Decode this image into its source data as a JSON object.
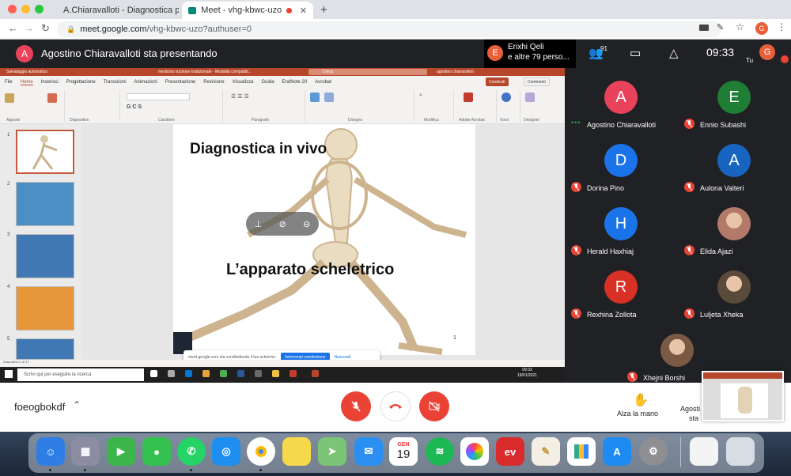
{
  "browser": {
    "tabs": [
      {
        "label": "A.Chiaravalloti - Diagnostica p",
        "icon": "drive-icon"
      },
      {
        "label": "Meet - vhg-kbwc-uzo",
        "icon": "meet-icon"
      }
    ],
    "url_host": "meet.google.com",
    "url_path": "/vhg-kbwc-uzo?authuser=0",
    "profile_initial": "G"
  },
  "meet": {
    "presenter_initial": "A",
    "presenter_banner": "Agostino Chiaravalloti sta presentando",
    "pinned": {
      "initial": "E",
      "line1": "Enxhi Qeli",
      "line2": "e altre 79 perso..."
    },
    "people_count": "91",
    "clock": "09:33",
    "you_label": "Tu",
    "you_initial": "G",
    "meeting_code": "foeogbokdf",
    "raise_hand_label": "Alza la mano",
    "self_caption_1": "Agosti",
    "self_caption_2": "sta",
    "participants": [
      {
        "name": "Agostino Chiaravalloti",
        "initial": "A",
        "color": "#e8435a",
        "muted": false,
        "photo": false
      },
      {
        "name": "Ennio Subashi",
        "initial": "E",
        "color": "#1e7e34",
        "muted": true,
        "photo": false
      },
      {
        "name": "Dorina Pino",
        "initial": "D",
        "color": "#1a73e8",
        "muted": true,
        "photo": false
      },
      {
        "name": "Aulona Valteri",
        "initial": "A",
        "color": "#1765c1",
        "muted": true,
        "photo": false
      },
      {
        "name": "Herald Haxhiaj",
        "initial": "H",
        "color": "#1a73e8",
        "muted": true,
        "photo": false
      },
      {
        "name": "Elida Ajazi",
        "initial": "",
        "color": "#b37a6a",
        "muted": true,
        "photo": true
      },
      {
        "name": "Rexhina Zollota",
        "initial": "R",
        "color": "#d93025",
        "muted": true,
        "photo": false
      },
      {
        "name": "Luljeta Xheka",
        "initial": "",
        "color": "#5a4a3a",
        "muted": true,
        "photo": true
      },
      {
        "name": "Xhejni Borshi",
        "initial": "",
        "color": "#7a5a44",
        "muted": true,
        "photo": true
      }
    ]
  },
  "ppt": {
    "autosave": "Salvataggio automatico",
    "doc_title": "medicina nucleare tradizionale - Modalità compatibi...",
    "search": "Cerca",
    "user": "agostino chiaravalloti",
    "user_initials": "AC",
    "menu": [
      "File",
      "Home",
      "Inserisci",
      "Progettazione",
      "Transizioni",
      "Animazioni",
      "Presentazione",
      "Revisione",
      "Visualizza",
      "Guida",
      "EndNote 20",
      "Acrobat"
    ],
    "share_btn": "Condividi",
    "comments_btn": "Commenti",
    "groups": [
      "Appunti",
      "Diapositive",
      "Carattere",
      "Paragrafo",
      "Disegno",
      "Modifica",
      "Adobe Acrobat",
      "Voce",
      "Designer"
    ],
    "slide_title": "Diagnostica in vivo",
    "slide_subtitle": "L’apparato scheletrico",
    "slide_number": "1",
    "thumb_numbers": [
      "1",
      "2",
      "3",
      "4",
      "5"
    ],
    "status": "Diapositiva 1 di 17",
    "share_notice": "meet.google.com sta condividendo il tuo schermo.",
    "stop_share": "Interrompi condivisione",
    "hide": "Nascondi",
    "win_search": "Scrivi qui per eseguire la ricerca",
    "win_time": "09:33",
    "win_date": "19/01/2021"
  },
  "dock": {
    "calendar_month": "GEN",
    "calendar_day": "19"
  }
}
